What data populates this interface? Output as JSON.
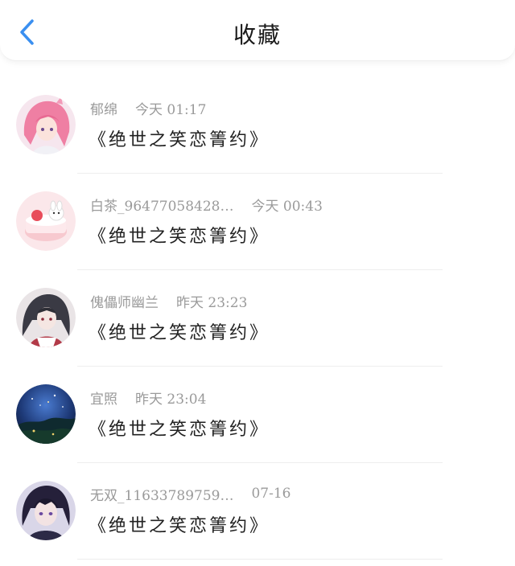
{
  "header": {
    "title": "收藏",
    "back_icon": "chevron-left-icon",
    "accent_color": "#3a8ff0"
  },
  "items": [
    {
      "name": "郁绵",
      "time": "今天 01:17",
      "snippet": "《绝世之笑恋箐约》",
      "avatar_icon": "anime-girl-pink-hair-avatar"
    },
    {
      "name": "白茶_96477058428…",
      "time": "今天 00:43",
      "snippet": "《绝世之笑恋箐约》",
      "avatar_icon": "cake-bunny-avatar"
    },
    {
      "name": "傀儡师幽兰",
      "time": "昨天 23:23",
      "snippet": "《绝世之笑恋箐约》",
      "avatar_icon": "anime-girl-dark-hair-avatar"
    },
    {
      "name": "宜照",
      "time": "昨天 23:04",
      "snippet": "《绝世之笑恋箐约》",
      "avatar_icon": "night-sky-avatar"
    },
    {
      "name": "无双_11633789759…",
      "time": "07-16",
      "snippet": "《绝世之笑恋箐约》",
      "avatar_icon": "anime-boy-avatar"
    }
  ]
}
